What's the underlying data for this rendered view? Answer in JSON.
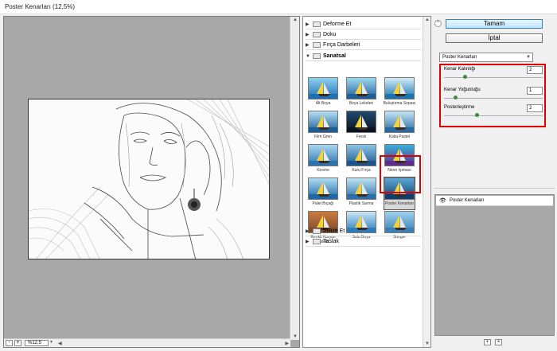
{
  "window": {
    "title": "Poster Kenarları (12,5%)"
  },
  "preview": {
    "zoom": "%12,5",
    "zoom_minus": "-",
    "zoom_plus": "+"
  },
  "gallery": {
    "folders": [
      {
        "label": "Deforme Et",
        "open": false
      },
      {
        "label": "Doku",
        "open": false
      },
      {
        "label": "Fırça Darbeleri",
        "open": false
      },
      {
        "label": "Sanatsal",
        "open": true
      },
      {
        "label": "Stilize Et",
        "open": false
      },
      {
        "label": "Taslak",
        "open": false
      }
    ],
    "thumbnails": [
      {
        "label": "Alt Boya"
      },
      {
        "label": "Boya Lekeleri"
      },
      {
        "label": "Buluştırma Sopası"
      },
      {
        "label": "Film Gren"
      },
      {
        "label": "Fresk"
      },
      {
        "label": "Kalia Pastel"
      },
      {
        "label": "Kesme"
      },
      {
        "label": "Kuru Fırça"
      },
      {
        "label": "Neon Işıması"
      },
      {
        "label": "Palet Bıçağı"
      },
      {
        "label": "Plastik Sarma"
      },
      {
        "label": "Poster Kenarları"
      },
      {
        "label": "Renkli Kurşun Kalem"
      },
      {
        "label": "Sulu Boya"
      },
      {
        "label": "Sünger"
      }
    ],
    "selected_index": 11
  },
  "buttons": {
    "ok": "Tamam",
    "cancel": "İptal"
  },
  "filter_select": {
    "value": "Poster Kenarları"
  },
  "params": [
    {
      "label": "Kenar Kalınlığı",
      "value": "2",
      "level": 0.2
    },
    {
      "label": "Kenar Yoğunluğu",
      "value": "1",
      "level": 0.1
    },
    {
      "label": "Posterleştirme",
      "value": "2",
      "level": 0.33
    }
  ],
  "layers": {
    "items": [
      {
        "label": "Poster Kenarları"
      }
    ]
  },
  "colors": {
    "highlight": "#e00000",
    "knob": "#3d8a3d"
  }
}
